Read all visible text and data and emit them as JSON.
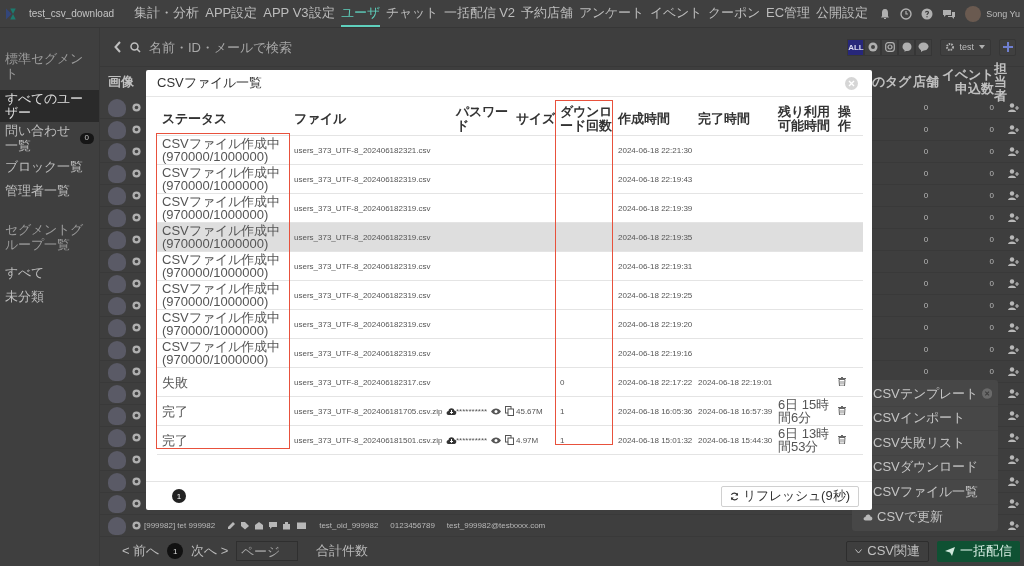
{
  "app": {
    "title": "test_csv_download",
    "user_name": "Song Yu",
    "nav": [
      {
        "label": "集計・分析",
        "selected": false
      },
      {
        "label": "APP設定",
        "selected": false
      },
      {
        "label": "APP V3設定",
        "selected": false
      },
      {
        "label": "ユーザ",
        "selected": true
      },
      {
        "label": "チャット",
        "selected": false
      },
      {
        "label": "一括配信 V2",
        "selected": false
      },
      {
        "label": "予約店舗",
        "selected": false
      },
      {
        "label": "アンケート",
        "selected": false
      },
      {
        "label": "イベント",
        "selected": false
      },
      {
        "label": "クーポン",
        "selected": false
      },
      {
        "label": "EC管理",
        "selected": false
      },
      {
        "label": "公開設定",
        "selected": false
      }
    ]
  },
  "sidebar": {
    "sections": [
      {
        "heading": "標準セグメント",
        "items": [
          {
            "label": "すべてのユーザー",
            "selected": true
          },
          {
            "label": "問い合わせ一覧",
            "selected": false,
            "badge": "0"
          },
          {
            "label": "ブロック一覧",
            "selected": false
          },
          {
            "label": "管理者一覧",
            "selected": false
          }
        ]
      },
      {
        "heading": "セグメントグループ一覧",
        "items": [
          {
            "label": "すべて",
            "selected": false
          },
          {
            "label": "未分類",
            "selected": false
          }
        ]
      }
    ]
  },
  "toolbar": {
    "search_placeholder": "名前・ID・メールで検索",
    "segment": "test",
    "channels": [
      {
        "kind": "all",
        "label": "ALL",
        "selected": true
      },
      {
        "kind": "chrome",
        "selected": false
      },
      {
        "kind": "instagram",
        "selected": false
      },
      {
        "kind": "messenger",
        "selected": false
      },
      {
        "kind": "line",
        "selected": false
      }
    ]
  },
  "users": {
    "columns": {
      "image": "画像",
      "tags": "のタグ",
      "store": "店舗",
      "events": "イベント申込数",
      "staff": "担当者"
    },
    "rows": [
      {
        "store": "0",
        "events": "0"
      },
      {
        "store": "0",
        "events": "0"
      },
      {
        "store": "0",
        "events": "0"
      },
      {
        "store": "0",
        "events": "0"
      },
      {
        "store": "0",
        "events": "0"
      },
      {
        "store": "0",
        "events": "0"
      },
      {
        "store": "0",
        "events": "0"
      },
      {
        "store": "0",
        "events": "0"
      },
      {
        "store": "0",
        "events": "0"
      },
      {
        "store": "0",
        "events": "0"
      },
      {
        "store": "0",
        "events": "0"
      },
      {
        "store": "0",
        "events": "0"
      },
      {
        "store": "0",
        "events": "0"
      },
      {},
      {},
      {},
      {},
      {},
      {}
    ],
    "last_row": {
      "id": "[999982] tet 999982",
      "oid": "test_oid_999982",
      "phone": "0123456789",
      "email": "test_999982@testxxxx.com"
    }
  },
  "pager": {
    "prev": "< 前へ",
    "page": "1",
    "next": "次へ >",
    "page_placeholder": "ページ",
    "total_label": "合計件数"
  },
  "csv_menu": {
    "items": [
      {
        "label": "CSVテンプレート",
        "closable": true
      },
      {
        "label": "CSVインポート"
      },
      {
        "label": "CSV失敗リスト"
      },
      {
        "label": "CSVダウンロード"
      },
      {
        "label": "CSVファイル一覧"
      },
      {
        "label": "CSVで更新",
        "cloud": true
      }
    ],
    "button": "CSV関連",
    "send_button": "一括配信"
  },
  "modal": {
    "title": "CSVファイル一覧",
    "columns": [
      "ステータス",
      "ファイル",
      "パスワード",
      "サイズ",
      "ダウンロード回数",
      "作成時間",
      "完了時間",
      "残り利用可能時間",
      "操作"
    ],
    "rows": [
      {
        "status": "CSVファイル作成中 (970000/1000000)",
        "file": "users_373_UTF-8_202406182321.csv",
        "downloadable": false,
        "created": "2024-06-18 22:21:30",
        "deletable": false,
        "highlighted": false
      },
      {
        "status": "CSVファイル作成中 (970000/1000000)",
        "file": "users_373_UTF-8_202406182319.csv",
        "downloadable": false,
        "created": "2024-06-18 22:19:43",
        "deletable": false,
        "highlighted": false
      },
      {
        "status": "CSVファイル作成中 (970000/1000000)",
        "file": "users_373_UTF-8_202406182319.csv",
        "downloadable": false,
        "created": "2024-06-18 22:19:39",
        "deletable": false,
        "highlighted": false
      },
      {
        "status": "CSVファイル作成中 (970000/1000000)",
        "file": "users_373_UTF-8_202406182319.csv",
        "downloadable": false,
        "created": "2024-06-18 22:19:35",
        "deletable": false,
        "highlighted": true
      },
      {
        "status": "CSVファイル作成中 (970000/1000000)",
        "file": "users_373_UTF-8_202406182319.csv",
        "downloadable": false,
        "created": "2024-06-18 22:19:31",
        "deletable": false,
        "highlighted": false
      },
      {
        "status": "CSVファイル作成中 (970000/1000000)",
        "file": "users_373_UTF-8_202406182319.csv",
        "downloadable": false,
        "created": "2024-06-18 22:19:25",
        "deletable": false,
        "highlighted": false
      },
      {
        "status": "CSVファイル作成中 (970000/1000000)",
        "file": "users_373_UTF-8_202406182319.csv",
        "downloadable": false,
        "created": "2024-06-18 22:19:20",
        "deletable": false,
        "highlighted": false
      },
      {
        "status": "CSVファイル作成中 (970000/1000000)",
        "file": "users_373_UTF-8_202406182319.csv",
        "downloadable": false,
        "created": "2024-06-18 22:19:16",
        "deletable": false,
        "highlighted": false
      },
      {
        "status": "失敗",
        "file": "users_373_UTF-8_202406182317.csv",
        "downloadable": false,
        "downloads": "0",
        "created": "2024-06-18 22:17:22",
        "completed": "2024-06-18 22:19:01",
        "deletable": true,
        "highlighted": false
      },
      {
        "status": "完了",
        "file": "users_373_UTF-8_202406181705.csv.zip",
        "downloadable": true,
        "password": "**********",
        "size": "45.67M",
        "downloads": "1",
        "created": "2024-06-18 16:05:36",
        "completed": "2024-06-18 16:57:39",
        "remaining": "6日 15時間6分",
        "deletable": true,
        "highlighted": false
      },
      {
        "status": "完了",
        "file": "users_373_UTF-8_202406181501.csv.zip",
        "downloadable": true,
        "password": "**********",
        "size": "4.97M",
        "downloads": "1",
        "created": "2024-06-18 15:01:32",
        "completed": "2024-06-18 15:44:30",
        "remaining": "6日 13時間53分",
        "deletable": true,
        "highlighted": false
      }
    ],
    "page": "1",
    "refresh": "リフレッシュ(9秒)"
  }
}
